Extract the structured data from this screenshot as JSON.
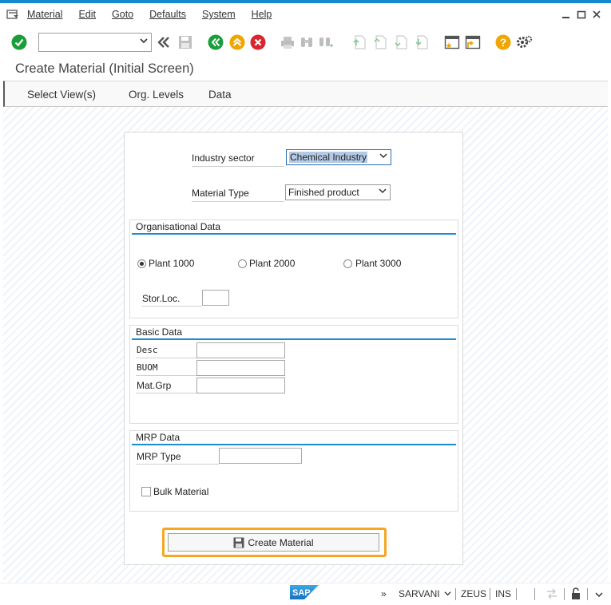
{
  "menubar": {
    "items": [
      "Material",
      "Edit",
      "Goto",
      "Defaults",
      "System",
      "Help"
    ]
  },
  "toolbar": {
    "command_field": ""
  },
  "page": {
    "title": "Create Material (Initial Screen)"
  },
  "appbar": {
    "items": [
      "Select View(s)",
      "Org. Levels",
      "Data"
    ]
  },
  "form": {
    "industry_sector_label": "Industry sector",
    "industry_sector_value": "Chemical Industry",
    "material_type_label": "Material Type",
    "material_type_value": "Finished product",
    "org_data": {
      "title": "Organisational Data",
      "plants": [
        "Plant 1000",
        "Plant 2000",
        "Plant 3000"
      ],
      "selected_plant": "Plant 1000",
      "storloc_label": "Stor.Loc.",
      "storloc_value": ""
    },
    "basic_data": {
      "title": "Basic Data",
      "desc_label": "Desc",
      "buom_label": "BUOM",
      "matgrp_label": "Mat.Grp",
      "desc_value": "",
      "buom_value": "",
      "matgrp_value": ""
    },
    "mrp_data": {
      "title": "MRP Data",
      "mrp_type_label": "MRP Type",
      "mrp_type_value": "",
      "bulk_label": "Bulk Material",
      "bulk_checked": false
    },
    "create_button_label": "Create Material"
  },
  "statusbar": {
    "logo": "SAP",
    "chevrons": "»",
    "user": "SARVANI",
    "system": "ZEUS",
    "mode": "INS"
  },
  "colors": {
    "accent_blue": "#1b8dcf",
    "highlight_orange": "#f5a623",
    "ok_green": "#1a9e3a",
    "cancel_red": "#d8262e",
    "help_yellow": "#f0a500"
  }
}
